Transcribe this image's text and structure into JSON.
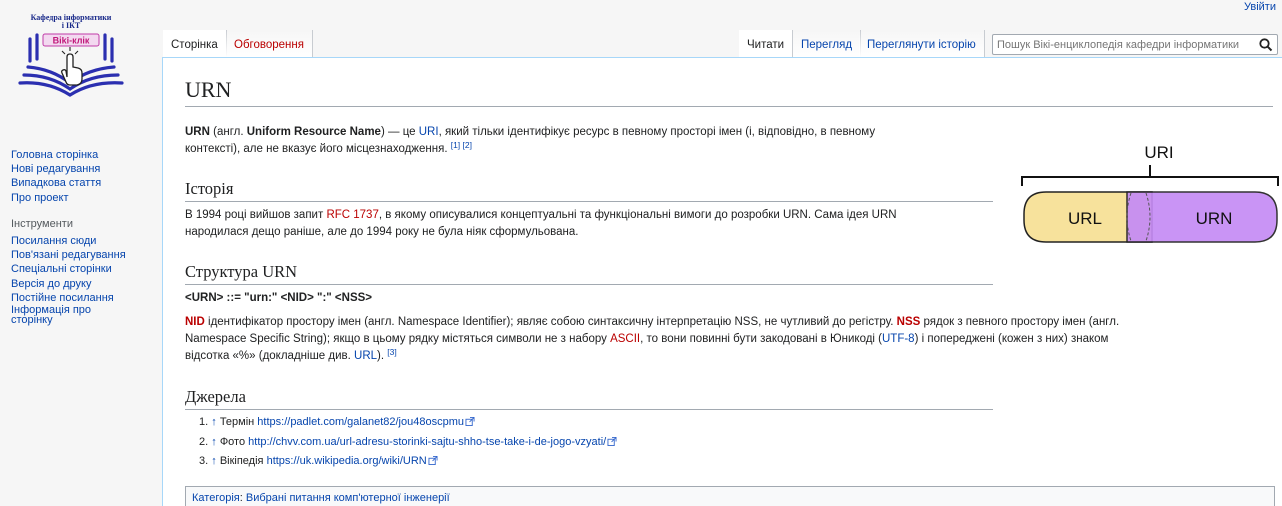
{
  "personal": {
    "login": "Увійти"
  },
  "logo": {
    "line1": "Кафедра інформатики",
    "line2": "і ІКТ",
    "badge": "Віki-клік"
  },
  "sidebar": {
    "nav": [
      "Головна сторінка",
      "Нові редагування",
      "Випадкова стаття",
      "Про проект"
    ],
    "tools_heading": "Інструменти",
    "tools": [
      "Посилання сюди",
      "Пов'язані редагування",
      "Спеціальні сторінки",
      "Версія до друку",
      "Постійне посилання",
      "Інформація про",
      "сторінку"
    ]
  },
  "tabs": {
    "page": "Сторінка",
    "discussion": "Обговорення",
    "read": "Читати",
    "view_source": "Перегляд",
    "history": "Переглянути історію"
  },
  "search": {
    "placeholder": "Пошук Вікі-енциклопедія кафедри інформатики"
  },
  "article": {
    "title": "URN",
    "intro": {
      "bold1": "URN",
      "t1": " (англ. ",
      "bold2": "Uniform Resource Name",
      "t2": ") — це ",
      "link_uri": "URI",
      "t3": ", який тільки ідентифікує ресурс в певному просторі імен (і, відповідно, в певному",
      "t4": "контексті), але не вказує його місцезнаходження. ",
      "ref1": "[1]",
      "ref2": "[2]"
    },
    "history": {
      "heading": "Історія",
      "t1": "В 1994 році вийшов запит ",
      "link_rfc": "RFC 1737",
      "t2": ", в якому описувалися концептуальні та функціональні вимоги до розробки URN. Сама ідея URN",
      "t3": "народилася дещо раніше, але до 1994 року не була ніяк сформульована."
    },
    "structure": {
      "heading": "Структура URN",
      "syntax": "<URN> ::= \"urn:\" <NID> \":\" <NSS>",
      "nid": "NID",
      "t1": " ідентифікатор простору імен (англ. Namespace Identifier); являє собою синтаксичну інтерпретацію NSS, не чутливий до регістру. ",
      "nss": "NSS",
      "t2": " рядок з певного простору імен (англ.",
      "t3": "Namespace Specific String); якщо в цьому рядку містяться символи не з набору ",
      "link_ascii": "ASCII",
      "t4": ", то вони повинні бути закодовані в Юникоді (",
      "link_utf8": "UTF-8",
      "t5": ") і попереджені (кожен з них) знаком",
      "t6": "відсотка «%» (докладніше див. ",
      "link_url": "URL",
      "t7": "). ",
      "ref3": "[3]"
    },
    "sources": {
      "heading": "Джерела",
      "items": [
        {
          "num": "1.",
          "arrow": "↑",
          "label": "Термін",
          "url": "https://padlet.com/galanet82/jou48oscpmu"
        },
        {
          "num": "2.",
          "arrow": "↑",
          "label": "Фото",
          "url": "http://chvv.com.ua/url-adresu-storinki-sajtu-shho-tse-take-i-de-jogo-vzyati/"
        },
        {
          "num": "3.",
          "arrow": "↑",
          "label": "Вікіпедія",
          "url": "https://uk.wikipedia.org/wiki/URN"
        }
      ]
    },
    "category": {
      "label": "Категорія",
      "value": "Вибрані питання комп'ютерної інженерії"
    }
  },
  "figure": {
    "top_label": "URI",
    "left_label": "URL",
    "right_label": "URN",
    "left_color": "#f7e29c",
    "right_color": "#c58bf5"
  }
}
